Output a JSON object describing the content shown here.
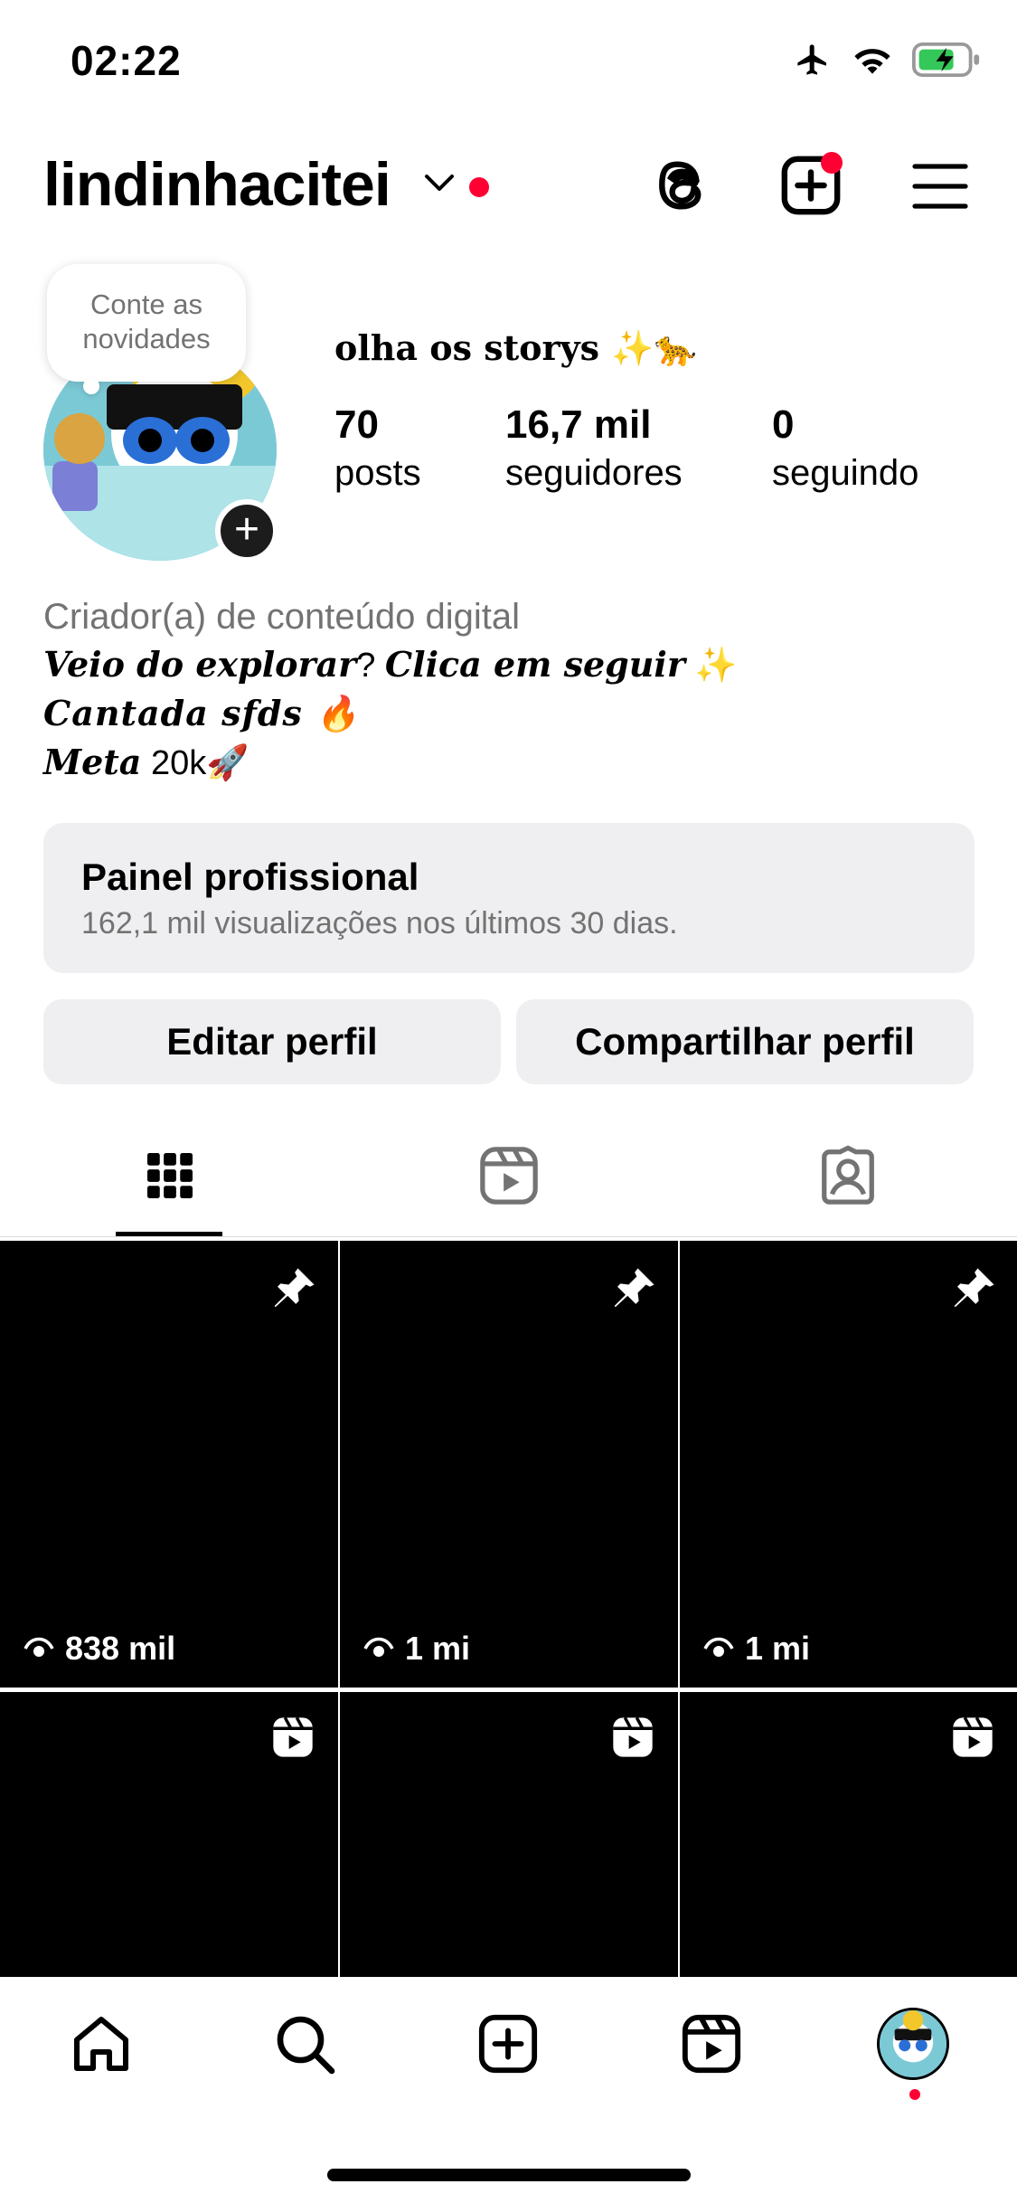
{
  "status_bar": {
    "time": "02:22"
  },
  "header": {
    "username": "lindinhacitei"
  },
  "profile": {
    "note_bubble": [
      "Conte as",
      "novidades"
    ],
    "name": "olha os storys ✨🐆",
    "stats": [
      {
        "value": "70",
        "label": "posts"
      },
      {
        "value": "16,7 mil",
        "label": "seguidores"
      },
      {
        "value": "0",
        "label": "seguindo"
      }
    ],
    "category": "Criador(a) de conteúdo digital",
    "bio": {
      "line1_a": "Veio do explorar",
      "line1_b": "? ",
      "line1_c": "Clica em seguir",
      "line1_d": " ✨",
      "line2": "Cantada sfds 🔥",
      "line3_a": "Meta",
      "line3_b": " 20k🚀"
    }
  },
  "panel": {
    "title": "Painel profissional",
    "subtitle": "162,1 mil visualizações nos últimos 30 dias."
  },
  "buttons": {
    "edit": "Editar perfil",
    "share": "Compartilhar perfil"
  },
  "grid": {
    "row1_views": [
      "838 mil",
      "1 mi",
      "1 mi"
    ]
  }
}
